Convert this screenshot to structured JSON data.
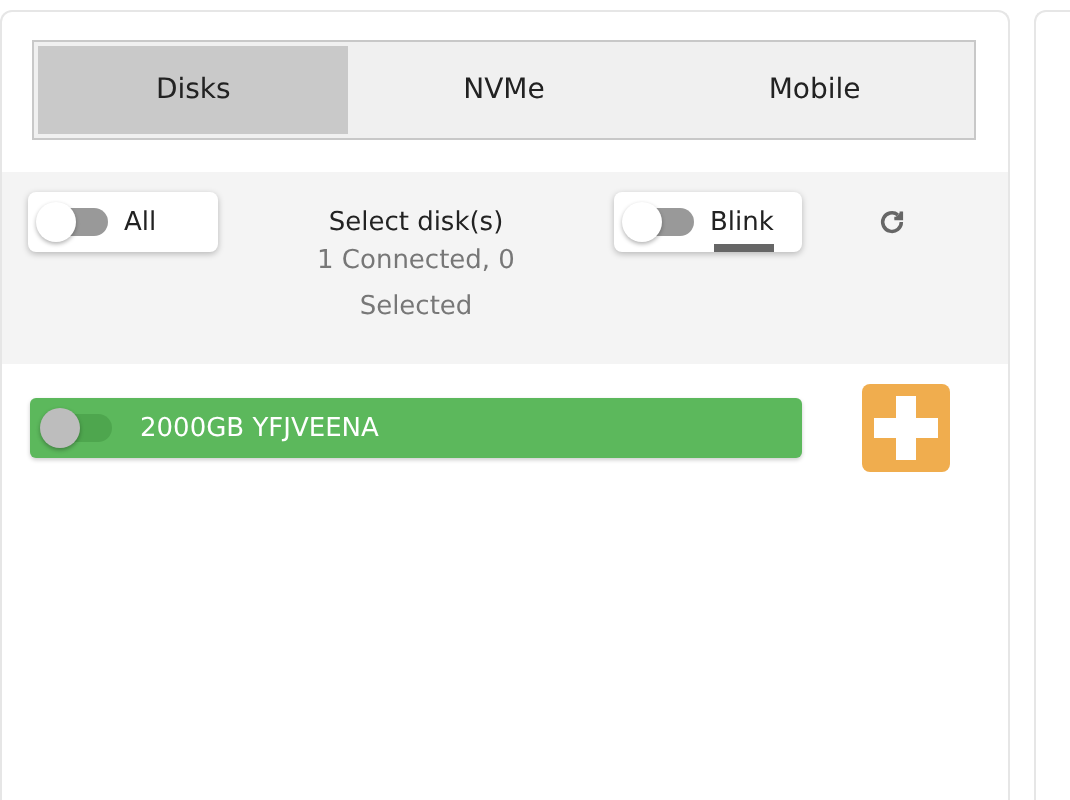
{
  "tabs": [
    {
      "label": "Disks",
      "selected": true
    },
    {
      "label": "NVMe",
      "selected": false
    },
    {
      "label": "Mobile",
      "selected": false
    }
  ],
  "toolbar": {
    "all_toggle": {
      "label": "All",
      "on": false
    },
    "title": "Select disk(s)",
    "status": "1 Connected, 0 Selected",
    "blink_toggle": {
      "label": "Blink",
      "on": false
    }
  },
  "disks": [
    {
      "label": "2000GB YFJVEENA",
      "selected": false
    }
  ]
}
